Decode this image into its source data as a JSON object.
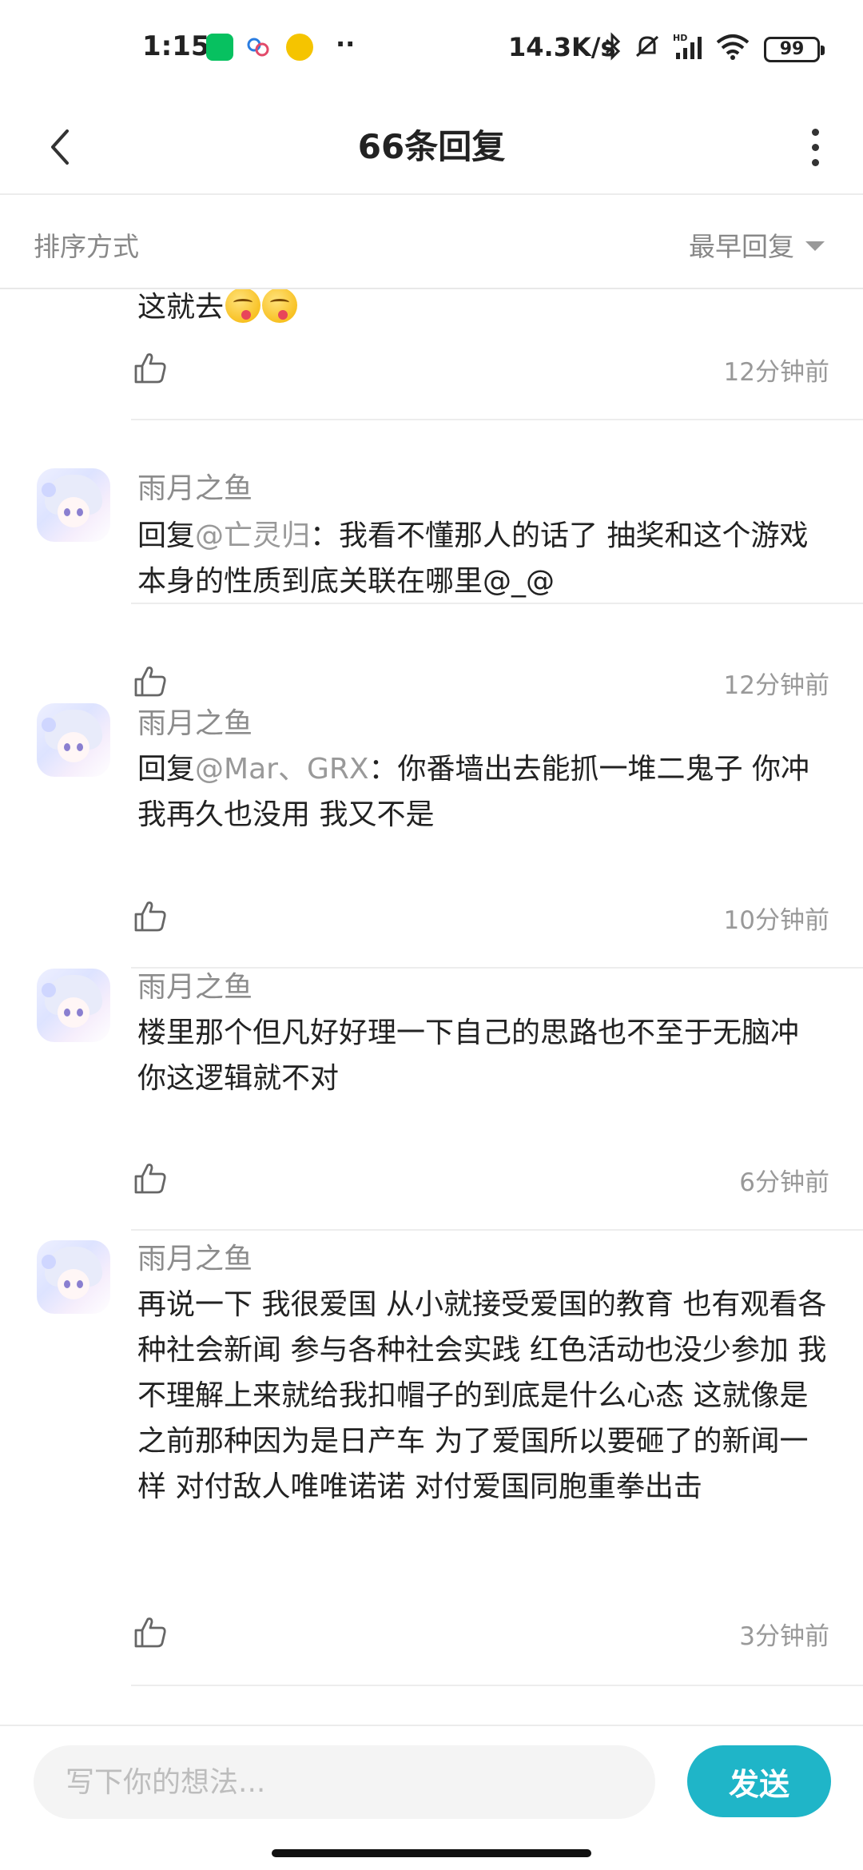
{
  "status_bar": {
    "time": "1:15",
    "more": "··",
    "network_speed": "14.3K/s",
    "battery": "99",
    "icons": [
      "wechat-icon",
      "cloud-icon",
      "qq-music-icon",
      "bluetooth-icon",
      "mute-icon",
      "hd-signal-icon",
      "wifi-icon",
      "battery-icon"
    ]
  },
  "header": {
    "title": "66条回复",
    "back_icon": "chevron-left-icon",
    "menu_icon": "more-vertical-icon"
  },
  "sort": {
    "label": "排序方式",
    "value": "最早回复"
  },
  "comments": [
    {
      "partial": true,
      "text": "这就去",
      "emoji": "yum-face-emoji",
      "time": "12分钟前"
    },
    {
      "username": "雨月之鱼",
      "reply_prefix": "回复",
      "mention": "@亡灵归",
      "text": "：我看不懂那人的话了  抽奖和这个游戏本身的性质到底关联在哪里@_@",
      "time": "12分钟前"
    },
    {
      "username": "雨月之鱼",
      "reply_prefix": "回复",
      "mention": "@Mar、GRX",
      "text": "：你番墙出去能抓一堆二鬼子  你冲我再久也没用   我又不是",
      "time": "10分钟前"
    },
    {
      "username": "雨月之鱼",
      "text": "楼里那个但凡好好理一下自己的思路也不至于无脑冲  你这逻辑就不对",
      "time": "6分钟前"
    },
    {
      "username": "雨月之鱼",
      "text": "再说一下  我很爱国  从小就接受爱国的教育 也有观看各种社会新闻  参与各种社会实践 红色活动也没少参加  我不理解上来就给我扣帽子的到底是什么心态  这就像是之前那种因为是日产车  为了爱国所以要砸了的新闻一样  对付敌人唯唯诺诺  对付爱国同胞重拳出击",
      "time": "3分钟前"
    }
  ],
  "input_bar": {
    "placeholder": "写下你的想法...",
    "send_label": "发送"
  },
  "colors": {
    "accent": "#1fb5c8",
    "secondary_text": "#999999"
  }
}
